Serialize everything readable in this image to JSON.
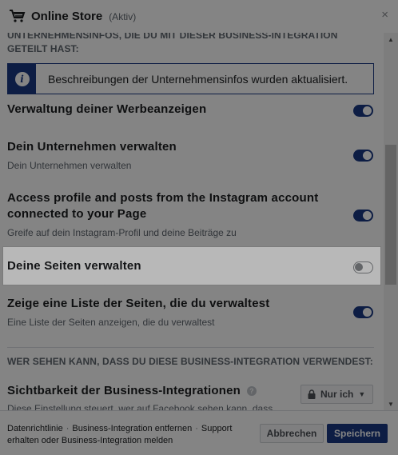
{
  "header": {
    "title": "Online Store",
    "status": "(Aktiv)",
    "close_label": "×"
  },
  "section_top": {
    "heading": "UNTERNEHMENSINFOS, DIE DU MIT DIESER BUSINESS-INTEGRATION GETEILT HAST:"
  },
  "info_banner": {
    "text": "Beschreibungen der Unternehmensinfos wurden aktualisiert."
  },
  "permissions": [
    {
      "title": "Verwaltung deiner Werbeanzeigen",
      "subtitle": "",
      "enabled": true
    },
    {
      "title": "Dein Unternehmen verwalten",
      "subtitle": "Dein Unternehmen verwalten",
      "enabled": true
    },
    {
      "title": "Access profile and posts from the Instagram account connected to your Page",
      "subtitle": "Greife auf dein Instagram-Profil und deine Beiträge zu",
      "enabled": true
    },
    {
      "title": "Deine Seiten verwalten",
      "subtitle": "",
      "enabled": false
    },
    {
      "title": "Zeige eine Liste der Seiten, die du verwaltest",
      "subtitle": "Eine Liste der Seiten anzeigen, die du verwaltest",
      "enabled": true
    }
  ],
  "section_visibility": {
    "heading": "WER SEHEN KANN, DASS DU DIESE BUSINESS-INTEGRATION VERWENDEST:",
    "title": "Sichtbarkeit der Business-Integrationen",
    "help_icon": "?",
    "subtitle": "Diese Einstellung steuert, wer auf Facebook sehen kann, dass",
    "dropdown_value": "Nur ich"
  },
  "footer": {
    "link_privacy": "Datenrichtlinie",
    "link_remove": "Business-Integration entfernen",
    "link_support": "Support erhalten oder Business-Integration melden",
    "separator": "·",
    "cancel_label": "Abbrechen",
    "save_label": "Speichern"
  },
  "colors": {
    "accent": "#1a3a84",
    "toggle_off": "#8a8d91",
    "overlay": "rgba(0,0,0,0.28)"
  },
  "icons": {
    "cart": "shopping-cart-icon",
    "info": "info-icon",
    "lock": "lock-icon",
    "help": "question-mark-icon"
  }
}
